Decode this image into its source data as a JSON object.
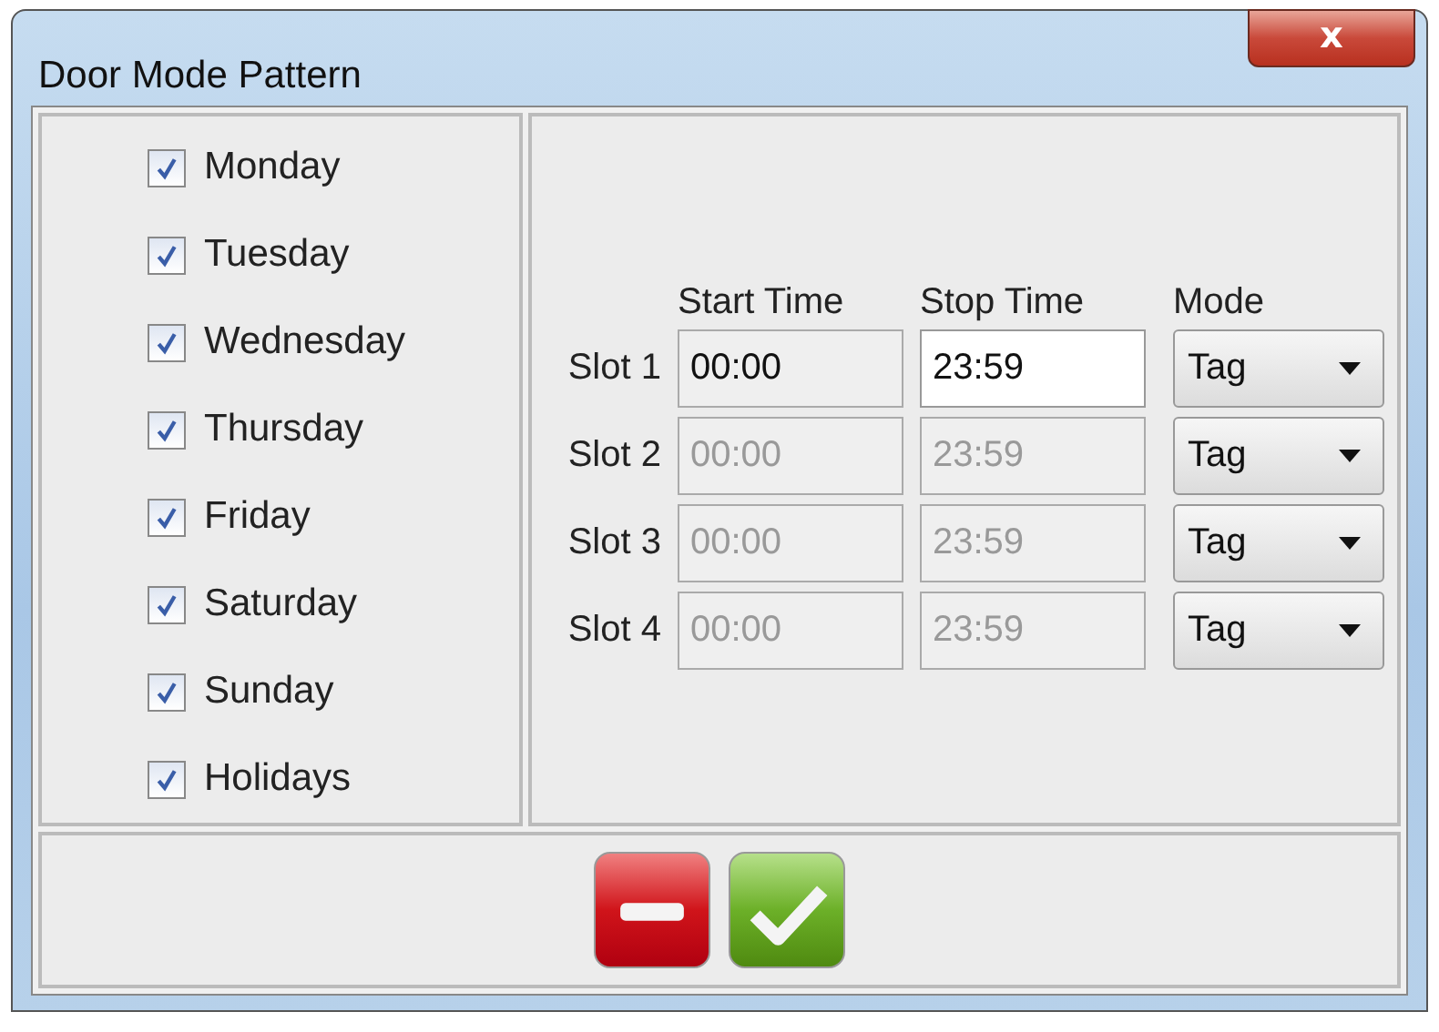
{
  "window": {
    "title": "Door Mode Pattern",
    "close_label": "x"
  },
  "days": [
    {
      "label": "Monday",
      "checked": true
    },
    {
      "label": "Tuesday",
      "checked": true
    },
    {
      "label": "Wednesday",
      "checked": true
    },
    {
      "label": "Thursday",
      "checked": true
    },
    {
      "label": "Friday",
      "checked": true
    },
    {
      "label": "Saturday",
      "checked": true
    },
    {
      "label": "Sunday",
      "checked": true
    },
    {
      "label": "Holidays",
      "checked": true
    }
  ],
  "slots": {
    "columns": [
      "Start Time",
      "Stop Time",
      "Mode"
    ],
    "rows": [
      {
        "label": "Slot 1",
        "start": {
          "value": "00:00",
          "disabled": false,
          "focused": false
        },
        "stop": {
          "value": "23:59",
          "disabled": false,
          "focused": true
        },
        "mode": "Tag"
      },
      {
        "label": "Slot 2",
        "start": {
          "value": "00:00",
          "disabled": true,
          "focused": false
        },
        "stop": {
          "value": "23:59",
          "disabled": true,
          "focused": false
        },
        "mode": "Tag"
      },
      {
        "label": "Slot 3",
        "start": {
          "value": "00:00",
          "disabled": true,
          "focused": false
        },
        "stop": {
          "value": "23:59",
          "disabled": true,
          "focused": false
        },
        "mode": "Tag"
      },
      {
        "label": "Slot 4",
        "start": {
          "value": "00:00",
          "disabled": true,
          "focused": false
        },
        "stop": {
          "value": "23:59",
          "disabled": true,
          "focused": false
        },
        "mode": "Tag"
      }
    ]
  },
  "buttons": [
    {
      "kind": "cancel"
    },
    {
      "kind": "ok"
    }
  ]
}
